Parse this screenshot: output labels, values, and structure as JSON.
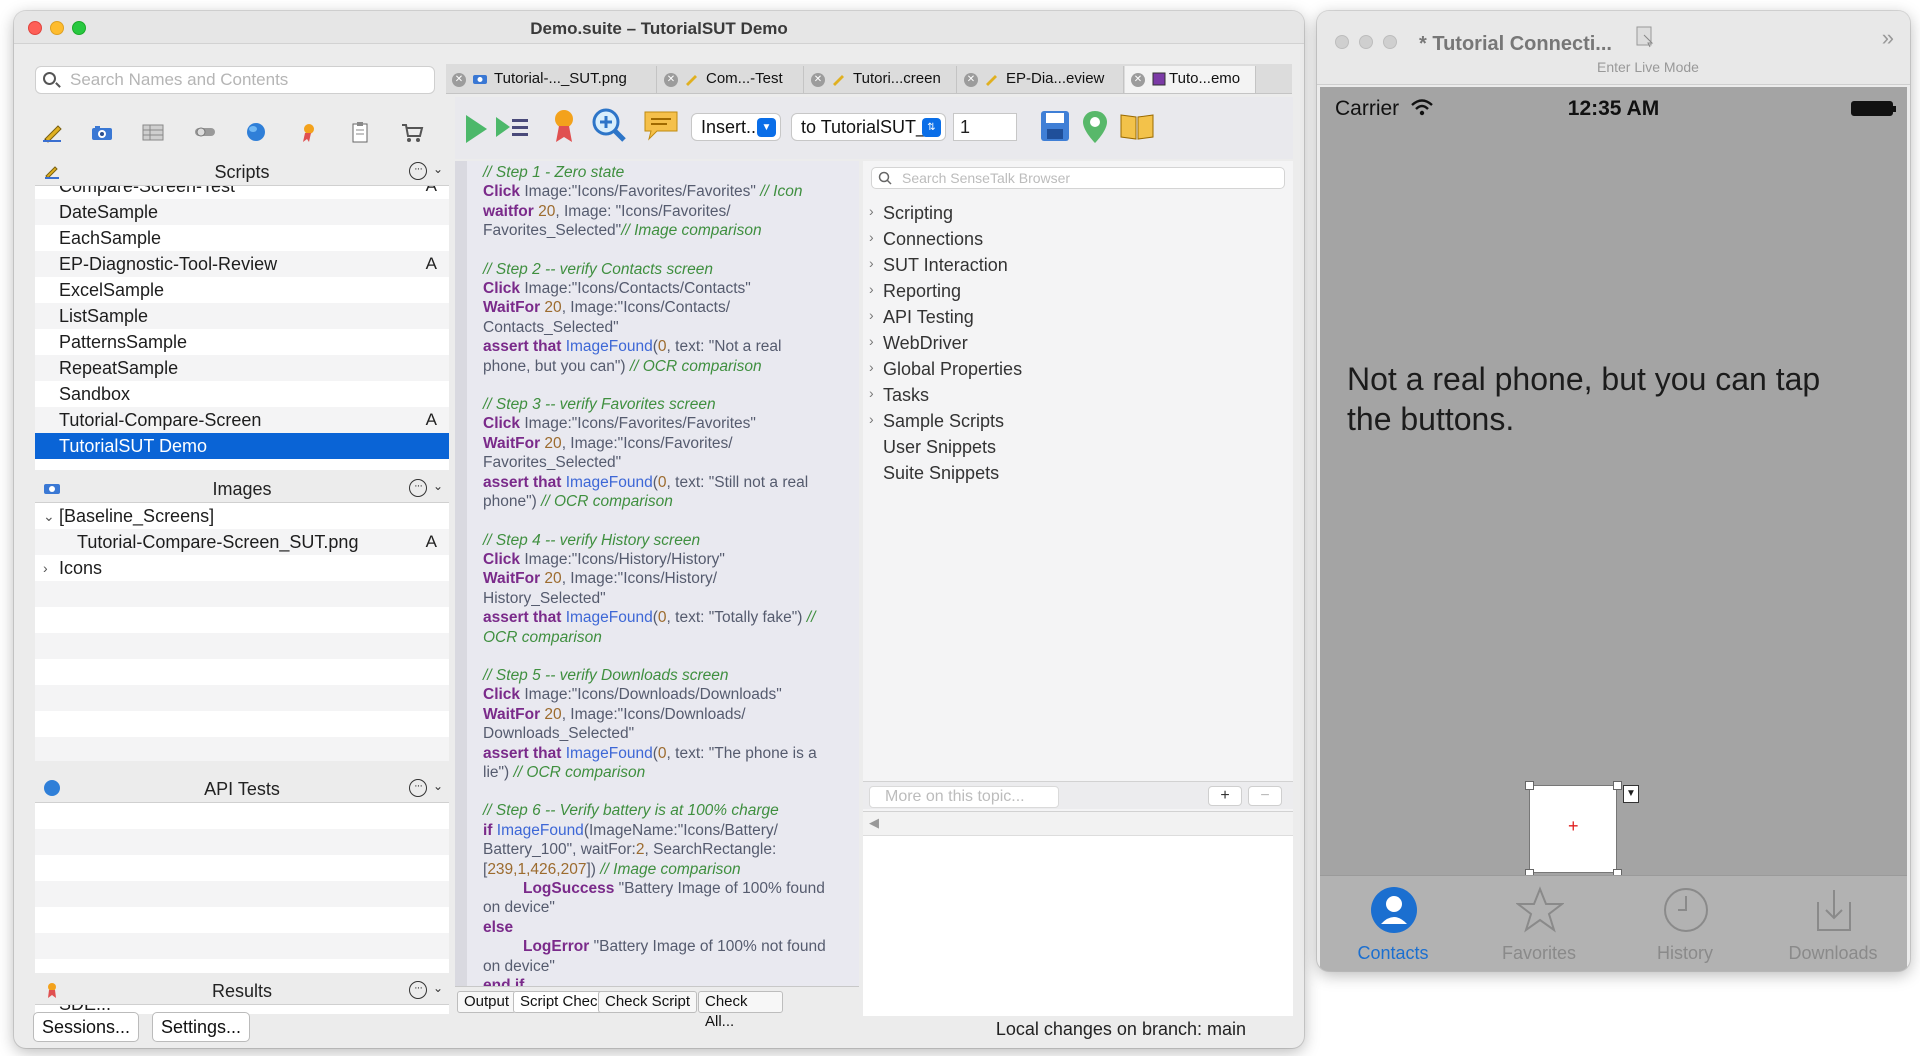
{
  "main_window": {
    "title": "Demo.suite – TutorialSUT Demo"
  },
  "search": {
    "placeholder": "Search Names and Contents"
  },
  "toolbar_icons": [
    "pencil-icon",
    "camera-icon",
    "grid-icon",
    "toggle-icon",
    "globe-icon",
    "ribbon-icon",
    "clipboard-icon",
    "cart-icon"
  ],
  "scripts": {
    "header": "Scripts",
    "items": [
      {
        "label": "Compare-Screen-Test",
        "badge": "A"
      },
      {
        "label": "DateSample",
        "badge": ""
      },
      {
        "label": "EachSample",
        "badge": ""
      },
      {
        "label": "EP-Diagnostic-Tool-Review",
        "badge": "A"
      },
      {
        "label": "ExcelSample",
        "badge": ""
      },
      {
        "label": "ListSample",
        "badge": ""
      },
      {
        "label": "PatternsSample",
        "badge": ""
      },
      {
        "label": "RepeatSample",
        "badge": ""
      },
      {
        "label": "Sandbox",
        "badge": ""
      },
      {
        "label": "Tutorial-Compare-Screen",
        "badge": "A"
      },
      {
        "label": "TutorialSUT Demo",
        "badge": ""
      }
    ]
  },
  "images": {
    "header": "Images",
    "items": [
      {
        "label": "[Baseline_Screens]",
        "badge": ""
      },
      {
        "label": "Tutorial-Compare-Screen_SUT.png",
        "badge": "A"
      },
      {
        "label": "Icons",
        "badge": ""
      }
    ]
  },
  "api_tests": {
    "header": "API Tests"
  },
  "results": {
    "header": "Results",
    "partial_item": "SDE..."
  },
  "bottom_buttons": {
    "sessions": "Sessions...",
    "settings": "Settings..."
  },
  "tabs": [
    {
      "label": "Tutorial-..._SUT.png",
      "icon": "camera-icon"
    },
    {
      "label": "Com...-Test",
      "icon": "pencil-icon"
    },
    {
      "label": "Tutori...creen",
      "icon": "pencil-icon"
    },
    {
      "label": "EP-Dia...eview",
      "icon": "pencil-icon"
    },
    {
      "label": "Tuto...emo",
      "icon": "script-icon"
    }
  ],
  "editor_toolbar": {
    "insert": "Insert...",
    "target": "to TutorialSUT_...",
    "count": "1"
  },
  "code": [
    {
      "t": "cm",
      "s": "// Step 1 - Zero state"
    },
    {
      "t": "mix",
      "parts": [
        [
          "kw",
          "Click"
        ],
        [
          "",
          " Image:\"Icons/Favorites/Favorites\" "
        ],
        [
          "cm",
          "// Icon"
        ]
      ]
    },
    {
      "t": "mix",
      "parts": [
        [
          "kw",
          "waitfor"
        ],
        [
          "nm",
          " 20"
        ],
        [
          "",
          ", Image: \"Icons/Favorites/"
        ]
      ]
    },
    {
      "t": "mix",
      "parts": [
        [
          "",
          "Favorites_Selected\""
        ],
        [
          "cm",
          "// Image comparison"
        ]
      ]
    },
    {
      "t": "gap"
    },
    {
      "t": "cm",
      "s": "// Step 2 -- verify Contacts screen"
    },
    {
      "t": "mix",
      "parts": [
        [
          "kw",
          "Click"
        ],
        [
          "",
          " Image:\"Icons/Contacts/Contacts\""
        ]
      ]
    },
    {
      "t": "mix",
      "parts": [
        [
          "kw",
          "WaitFor"
        ],
        [
          "nm",
          " 20"
        ],
        [
          "",
          ", Image:\"Icons/Contacts/"
        ]
      ]
    },
    {
      "t": "mix",
      "parts": [
        [
          "",
          "Contacts_Selected\""
        ]
      ]
    },
    {
      "t": "mix",
      "parts": [
        [
          "kw",
          "assert that"
        ],
        [
          "fn",
          " ImageFound"
        ],
        [
          "",
          "("
        ],
        [
          "nm",
          "0"
        ],
        [
          "",
          ", text: \"Not a real"
        ]
      ]
    },
    {
      "t": "mix",
      "parts": [
        [
          "",
          "phone, but you can\") "
        ],
        [
          "cm",
          "// OCR comparison"
        ]
      ]
    },
    {
      "t": "gap"
    },
    {
      "t": "cm",
      "s": "// Step 3 -- verify Favorites screen"
    },
    {
      "t": "mix",
      "parts": [
        [
          "kw",
          "Click"
        ],
        [
          "",
          " Image:\"Icons/Favorites/Favorites\""
        ]
      ]
    },
    {
      "t": "mix",
      "parts": [
        [
          "kw",
          "WaitFor"
        ],
        [
          "nm",
          " 20"
        ],
        [
          "",
          ", Image:\"Icons/Favorites/"
        ]
      ]
    },
    {
      "t": "mix",
      "parts": [
        [
          "",
          "Favorites_Selected\""
        ]
      ]
    },
    {
      "t": "mix",
      "parts": [
        [
          "kw",
          "assert that"
        ],
        [
          "fn",
          " ImageFound"
        ],
        [
          "",
          "("
        ],
        [
          "nm",
          "0"
        ],
        [
          "",
          ", text: \"Still not a real"
        ]
      ]
    },
    {
      "t": "mix",
      "parts": [
        [
          "",
          "phone\") "
        ],
        [
          "cm",
          "// OCR comparison"
        ]
      ]
    },
    {
      "t": "gap"
    },
    {
      "t": "cm",
      "s": "// Step 4 -- verify History screen"
    },
    {
      "t": "mix",
      "parts": [
        [
          "kw",
          "Click"
        ],
        [
          "",
          " Image:\"Icons/History/History\""
        ]
      ]
    },
    {
      "t": "mix",
      "parts": [
        [
          "kw",
          "WaitFor"
        ],
        [
          "nm",
          " 20"
        ],
        [
          "",
          ", Image:\"Icons/History/"
        ]
      ]
    },
    {
      "t": "mix",
      "parts": [
        [
          "",
          "History_Selected\""
        ]
      ]
    },
    {
      "t": "mix",
      "parts": [
        [
          "kw",
          "assert that"
        ],
        [
          "fn",
          " ImageFound"
        ],
        [
          "",
          "("
        ],
        [
          "nm",
          "0"
        ],
        [
          "",
          ", text: \"Totally fake\") "
        ],
        [
          "cm",
          "//"
        ]
      ]
    },
    {
      "t": "cm",
      "s": "OCR comparison"
    },
    {
      "t": "gap"
    },
    {
      "t": "cm",
      "s": "// Step 5 -- verify Downloads screen"
    },
    {
      "t": "mix",
      "parts": [
        [
          "kw",
          "Click"
        ],
        [
          "",
          " Image:\"Icons/Downloads/Downloads\""
        ]
      ]
    },
    {
      "t": "mix",
      "parts": [
        [
          "kw",
          "WaitFor"
        ],
        [
          "nm",
          " 20"
        ],
        [
          "",
          ", Image:\"Icons/Downloads/"
        ]
      ]
    },
    {
      "t": "mix",
      "parts": [
        [
          "",
          "Downloads_Selected\""
        ]
      ]
    },
    {
      "t": "mix",
      "parts": [
        [
          "kw",
          "assert that"
        ],
        [
          "fn",
          " ImageFound"
        ],
        [
          "",
          "("
        ],
        [
          "nm",
          "0"
        ],
        [
          "",
          ", text: \"The phone is a"
        ]
      ]
    },
    {
      "t": "mix",
      "parts": [
        [
          "",
          "lie\") "
        ],
        [
          "cm",
          "// OCR comparison"
        ]
      ]
    },
    {
      "t": "gap"
    },
    {
      "t": "cm",
      "s": "// Step 6 -- Verify battery is at 100% charge"
    },
    {
      "t": "mix",
      "parts": [
        [
          "kw",
          "if"
        ],
        [
          "fn",
          " ImageFound"
        ],
        [
          "",
          "(ImageName:\"Icons/Battery/"
        ]
      ]
    },
    {
      "t": "mix",
      "parts": [
        [
          "",
          "Battery_100\", waitFor:"
        ],
        [
          "nm",
          "2"
        ],
        [
          "",
          ", SearchRectangle:"
        ]
      ]
    },
    {
      "t": "mix",
      "parts": [
        [
          "",
          "["
        ],
        [
          "nm",
          "239,1,426,207"
        ],
        [
          "",
          "]) "
        ],
        [
          "cm",
          "// Image comparison"
        ]
      ]
    },
    {
      "t": "mix",
      "ind": true,
      "parts": [
        [
          "kw",
          "LogSuccess"
        ],
        [
          "",
          " \"Battery Image of 100% found"
        ]
      ]
    },
    {
      "t": "mix",
      "parts": [
        [
          "",
          "on device\""
        ]
      ]
    },
    {
      "t": "mix",
      "parts": [
        [
          "kw",
          "else"
        ]
      ]
    },
    {
      "t": "mix",
      "ind": true,
      "parts": [
        [
          "kw",
          "LogError"
        ],
        [
          "",
          " \"Battery Image of 100% not found"
        ]
      ]
    },
    {
      "t": "mix",
      "parts": [
        [
          "",
          "on device\""
        ]
      ]
    },
    {
      "t": "mix",
      "parts": [
        [
          "kw",
          "end if"
        ]
      ]
    }
  ],
  "editor_bottom": {
    "output": "Output",
    "script_check": "Script Check",
    "check_script": "Check Script",
    "check_all": "Check All..."
  },
  "browser": {
    "search_placeholder": "Search SenseTalk Browser",
    "items": [
      {
        "label": "Scripting",
        "expandable": true
      },
      {
        "label": "Connections",
        "expandable": true
      },
      {
        "label": "SUT Interaction",
        "expandable": true
      },
      {
        "label": "Reporting",
        "expandable": true
      },
      {
        "label": "API Testing",
        "expandable": true
      },
      {
        "label": "WebDriver",
        "expandable": true
      },
      {
        "label": "Global Properties",
        "expandable": true
      },
      {
        "label": "Tasks",
        "expandable": true
      },
      {
        "label": "Sample Scripts",
        "expandable": true
      },
      {
        "label": "User Snippets",
        "expandable": false
      },
      {
        "label": "Suite Snippets",
        "expandable": false
      }
    ],
    "more_on_topic": "More on this topic...",
    "plus": "+",
    "minus": "−"
  },
  "status_text": "Local changes on branch: main",
  "phone_window": {
    "title": "* Tutorial Connecti...",
    "live_mode": "Enter Live Mode",
    "carrier": "Carrier",
    "time": "12:35 AM",
    "message": "Not a real phone, but you can tap the buttons.",
    "tabs": [
      {
        "label": "Contacts",
        "icon": "person-icon",
        "active": true
      },
      {
        "label": "Favorites",
        "icon": "star-icon",
        "active": false
      },
      {
        "label": "History",
        "icon": "clock-icon",
        "active": false
      },
      {
        "label": "Downloads",
        "icon": "download-icon",
        "active": false
      }
    ]
  },
  "colors": {
    "selection": "#0a64d6",
    "comment": "#3f8f3f",
    "keyword": "#7a2a8a",
    "function": "#3d67d6",
    "phone_active_tab": "#1b6fd0"
  }
}
